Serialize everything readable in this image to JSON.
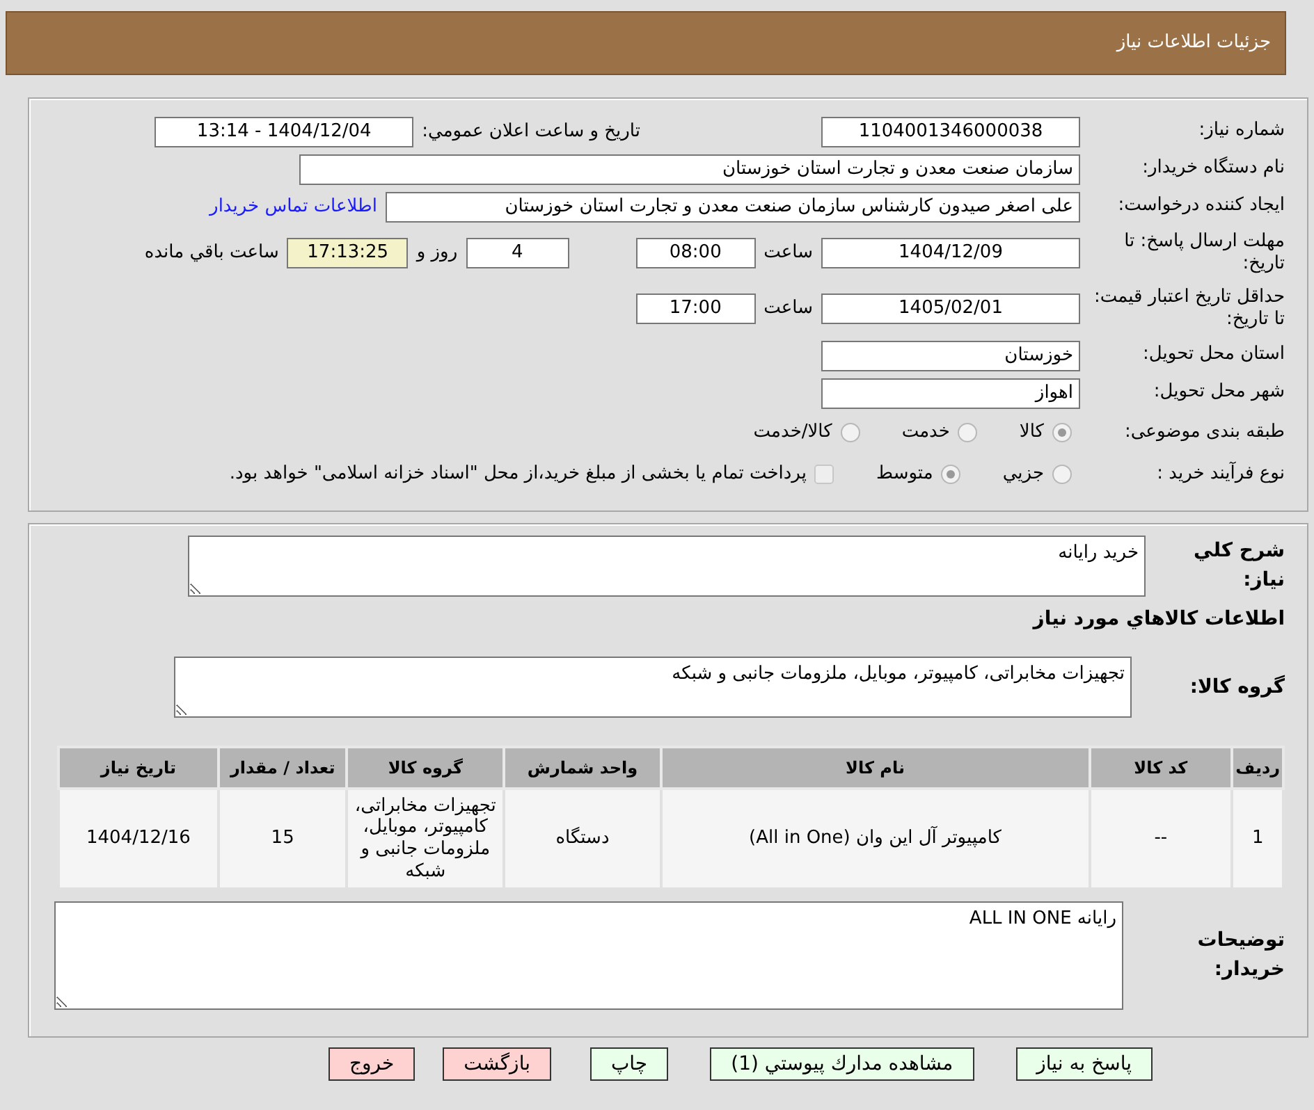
{
  "header": {
    "title": "جزئيات اطلاعات نياز"
  },
  "need_number": {
    "label": "شماره نياز:",
    "value": "1104001346000038"
  },
  "announce": {
    "label": "تاريخ و ساعت اعلان عمومي:",
    "value": "1404/12/04 - 13:14"
  },
  "buyer": {
    "label": "نام دستگاه خريدار:",
    "value": "سازمان صنعت معدن و تجارت استان خوزستان"
  },
  "creator": {
    "label": "ايجاد کننده درخواست:",
    "value": "علی اصغر صیدون کارشناس سازمان صنعت معدن و تجارت استان خوزستان",
    "link": "اطلاعات تماس خريدار"
  },
  "deadline": {
    "label": "مهلت ارسال پاسخ: تا تاريخ:",
    "date": "1404/12/09",
    "time_label": "ساعت",
    "time": "08:00",
    "days": "4",
    "days_label": "روز و",
    "remaining": "17:13:25",
    "remaining_label": "ساعت باقي مانده"
  },
  "validity": {
    "label": "حداقل تاريخ اعتبار قيمت: تا تاريخ:",
    "date": "1405/02/01",
    "time_label": "ساعت",
    "time": "17:00"
  },
  "province": {
    "label": "استان محل تحويل:",
    "value": "خوزستان"
  },
  "city": {
    "label": "شهر محل تحويل:",
    "value": "اهواز"
  },
  "category": {
    "label": "طبقه بندی موضوعی:",
    "options": [
      {
        "label": "کالا",
        "selected": true
      },
      {
        "label": "خدمت",
        "selected": false
      },
      {
        "label": "کالا/خدمت",
        "selected": false
      }
    ]
  },
  "process": {
    "label": "نوع فرآيند خريد :",
    "options": [
      {
        "label": "جزيي",
        "selected": false
      },
      {
        "label": "متوسط",
        "selected": true
      }
    ],
    "treasury": {
      "label": "پرداخت تمام يا بخشی از مبلغ خريد،از محل \"اسناد خزانه اسلامی\" خواهد بود.",
      "checked": false
    }
  },
  "description": {
    "label": "شرح کلي نياز:",
    "value": "خريد رايانه"
  },
  "goods_heading": "اطلاعات کالاهاي مورد نياز",
  "goods_group": {
    "label": "گروه کالا:",
    "value": "تجهیزات مخابراتی، کامپیوتر، موبایل، ملزومات جانبی و شبکه"
  },
  "table": {
    "columns": [
      "رديف",
      "کد کالا",
      "نام کالا",
      "واحد شمارش",
      "گروه کالا",
      "تعداد / مقدار",
      "تاريخ نياز"
    ],
    "rows": [
      [
        "1",
        "--",
        "کامپیوتر آل این وان (All in One)",
        "دستگاه",
        "تجهیزات مخابراتی، کامپیوتر، موبایل، ملزومات جانبی و شبکه",
        "15",
        "1404/12/16"
      ]
    ]
  },
  "buyer_notes": {
    "label": "توضيحات خريدار:",
    "value": "رايانه ALL IN ONE"
  },
  "buttons": [
    {
      "label": "پاسخ به نياز",
      "kind": "action"
    },
    {
      "label": "مشاهده مدارك پيوستي (1)",
      "kind": "action"
    },
    {
      "label": "چاپ",
      "kind": "action"
    },
    {
      "label": "بازگشت",
      "kind": "exit"
    },
    {
      "label": "خروج",
      "kind": "exit"
    }
  ]
}
